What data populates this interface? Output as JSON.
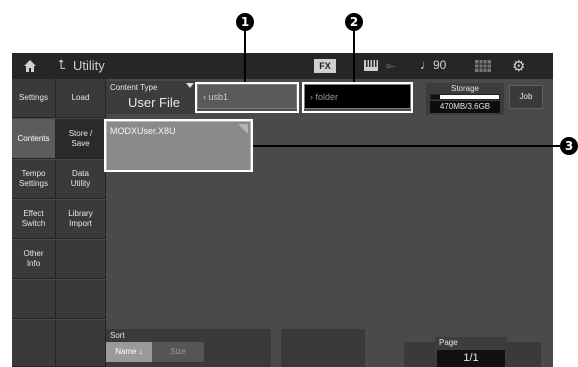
{
  "topbar": {
    "title": "Utility",
    "fx_label": "FX",
    "tempo": "90",
    "icons": [
      "home-icon",
      "back-arrow-icon",
      "keyboard-icon",
      "usb-icon",
      "note-icon",
      "grid-icon",
      "gear-icon"
    ]
  },
  "nav_primary": [
    {
      "label": "Settings"
    },
    {
      "label": "Contents"
    },
    {
      "label": "Tempo Settings"
    },
    {
      "label": "Effect Switch"
    },
    {
      "label": "Other Info"
    }
  ],
  "nav_secondary": [
    {
      "label": "Load"
    },
    {
      "label": "Store / Save"
    },
    {
      "label": "Data Utility"
    },
    {
      "label": "Library Import"
    }
  ],
  "content_type": {
    "label": "Content Type",
    "value": "User File"
  },
  "path": {
    "device": "usb1",
    "folder": "folder"
  },
  "storage": {
    "label": "Storage",
    "value": "470MB/3.6GB",
    "used_fraction": 0.13
  },
  "job_label": "Job",
  "files": [
    {
      "name": "MODXUser.X8U"
    }
  ],
  "sort": {
    "label": "Sort",
    "name_label": "Name ↓",
    "size_label": "Size"
  },
  "page": {
    "label": "Page",
    "value": "1/1"
  },
  "callouts": [
    "1",
    "2",
    "3"
  ],
  "colors": {
    "screen_bg": "#4a4a4a",
    "topbar_bg": "#262626",
    "selected_tile": "#8a8a8a",
    "highlight": "#ffffff"
  }
}
